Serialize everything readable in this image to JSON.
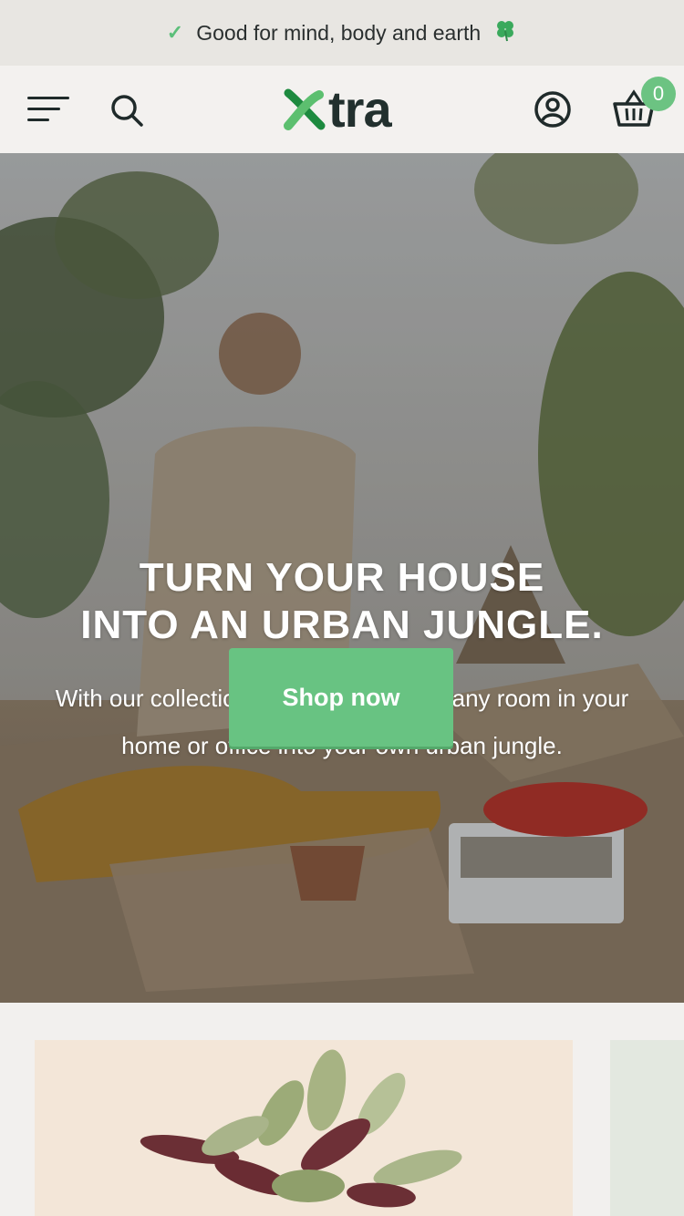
{
  "announcement": {
    "text": "Good for mind, body and earth",
    "check_icon": "check-icon",
    "clover_icon": "four-leaf-clover-icon"
  },
  "header": {
    "logo_text": "tra",
    "logo_mark": "x-leaf-logo-icon",
    "cart_count": "0"
  },
  "hero": {
    "title_line1": "TURN YOUR HOUSE",
    "title_line2": "INTO AN URBAN JUNGLE.",
    "subtitle": "With our collection you can transform any room in your home or office into your own urban jungle.",
    "cta_label": "Shop now"
  },
  "colors": {
    "accent": "#68c382",
    "announcement_bg": "#e8e6e2",
    "header_bg": "#f3f1ef",
    "logo_text": "#22302e",
    "card_bg": "#f3e6d8"
  }
}
